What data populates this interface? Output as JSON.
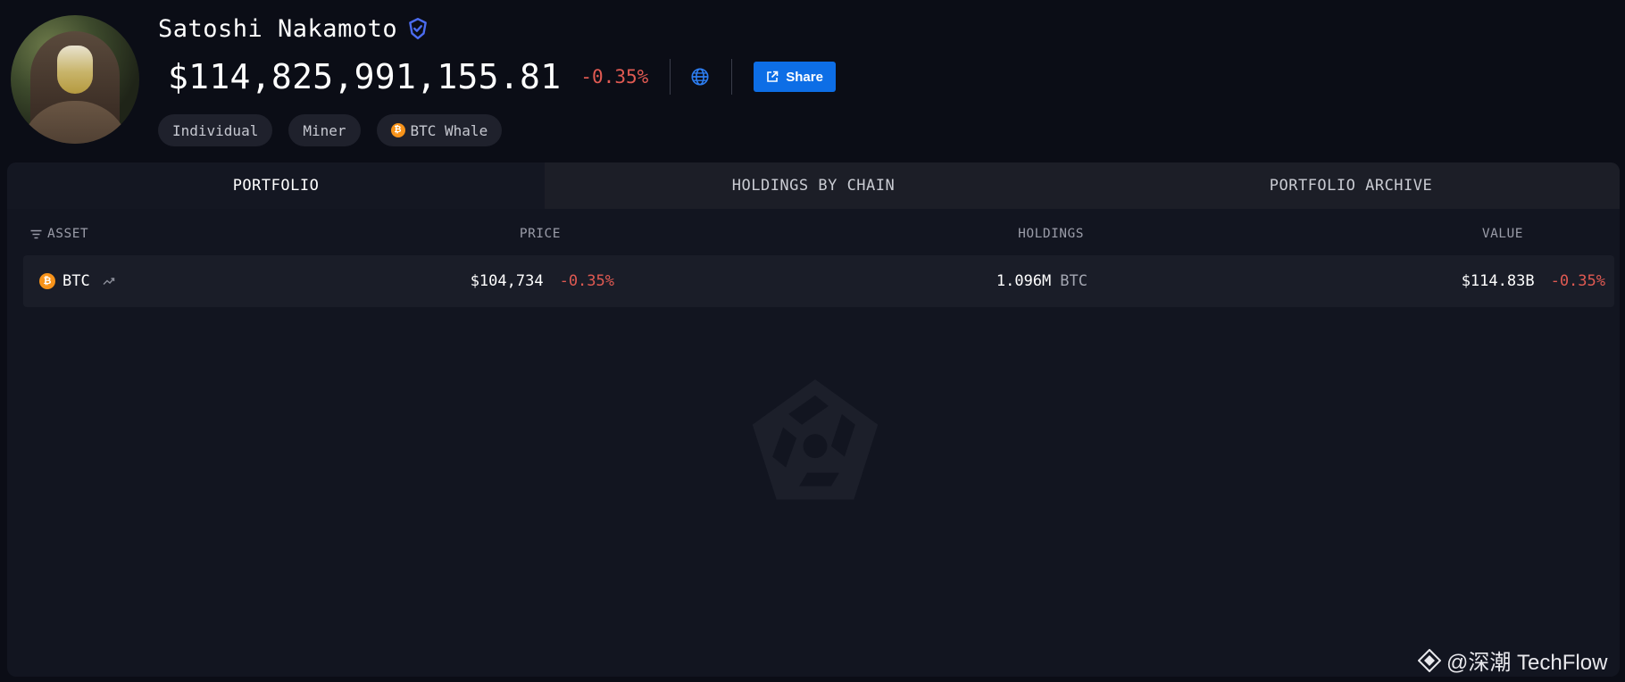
{
  "profile": {
    "name": "Satoshi Nakamoto",
    "balance": "$114,825,991,155.81",
    "balance_change": "-0.35%",
    "share_label": "Share",
    "tags": [
      {
        "label": "Individual",
        "icon": ""
      },
      {
        "label": "Miner",
        "icon": ""
      },
      {
        "label": "BTC Whale",
        "icon": "bitcoin-icon"
      }
    ]
  },
  "tabs": [
    {
      "label": "PORTFOLIO",
      "active": true
    },
    {
      "label": "HOLDINGS BY CHAIN",
      "active": false
    },
    {
      "label": "PORTFOLIO ARCHIVE",
      "active": false
    }
  ],
  "table": {
    "headers": {
      "asset": "ASSET",
      "price": "PRICE",
      "holdings": "HOLDINGS",
      "value": "VALUE"
    },
    "rows": [
      {
        "symbol": "BTC",
        "price": "$104,734",
        "price_change": "-0.35%",
        "holdings_amount": "1.096M",
        "holdings_unit": "BTC",
        "value": "$114.83B",
        "value_change": "-0.35%"
      }
    ]
  },
  "footer": {
    "watermark": "@深潮 TechFlow"
  },
  "colors": {
    "background": "#0b0d16",
    "panel": "#121520",
    "accent": "#0d6ee6",
    "negative": "#e05a52",
    "bitcoin": "#f7931a",
    "verified": "#4b6cf0"
  }
}
